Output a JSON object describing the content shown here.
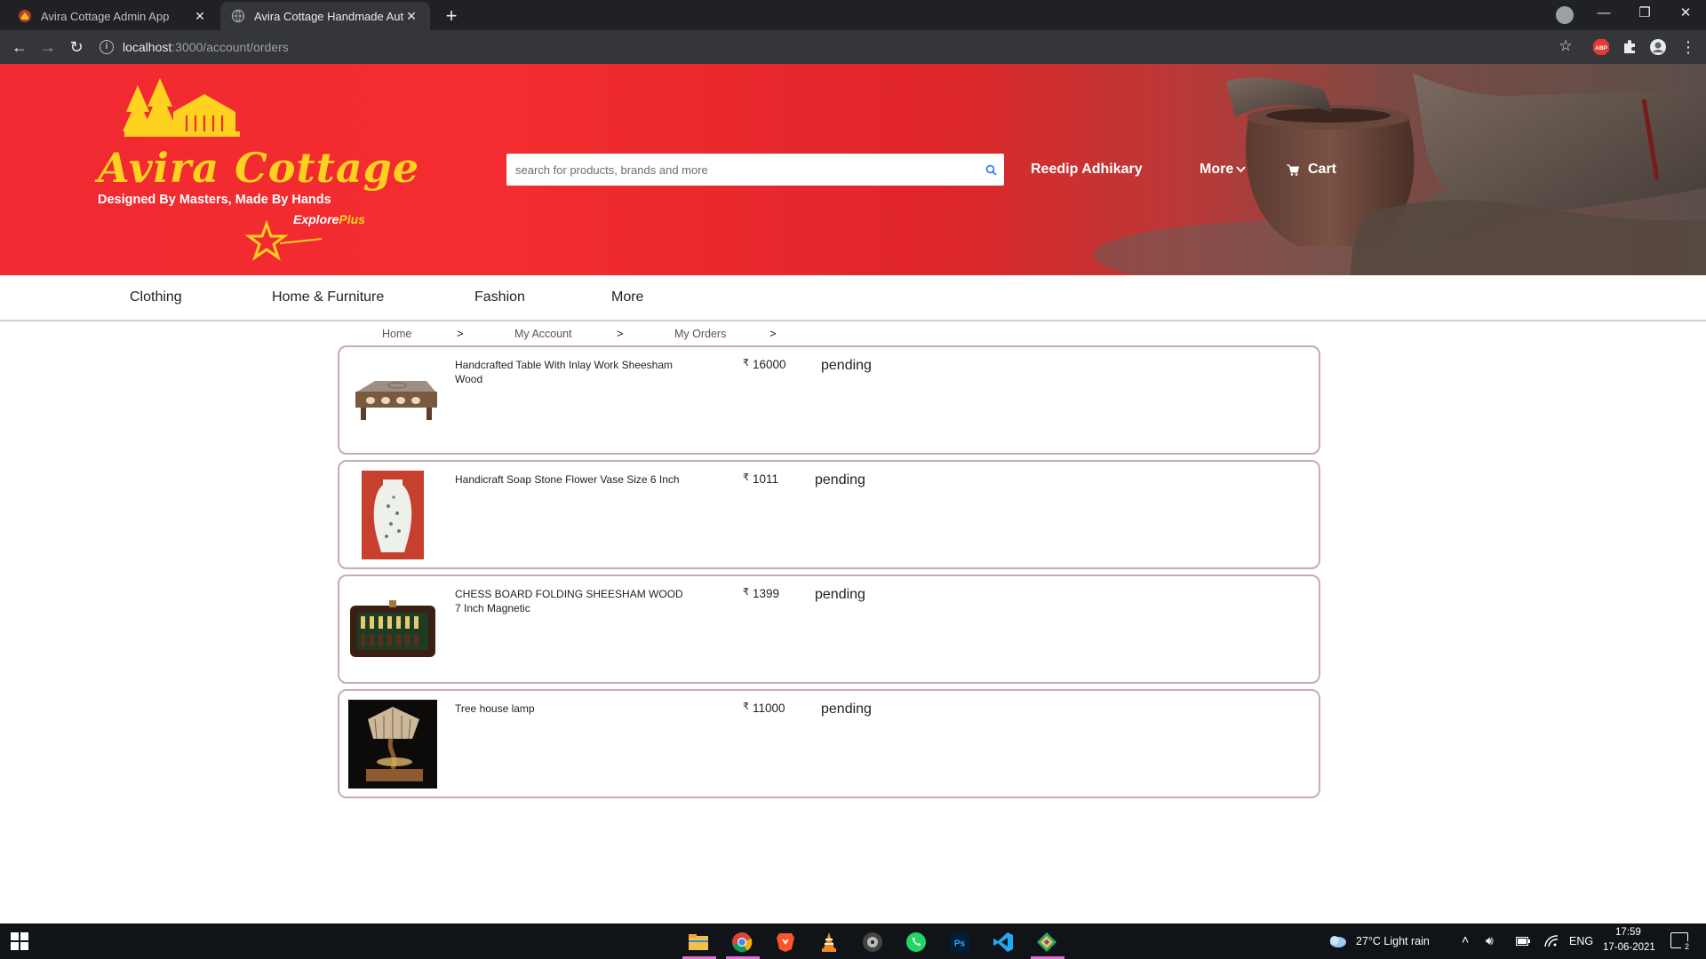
{
  "browser": {
    "tabs": [
      {
        "title": "Avira Cottage Admin App",
        "active": false
      },
      {
        "title": "Avira Cottage Handmade Authen",
        "active": true
      }
    ],
    "url_host": "localhost",
    "url_path": ":3000/account/orders",
    "new_tab_label": "+"
  },
  "header": {
    "logo_title": "Avira Cottage",
    "logo_tagline": "Designed By Masters, Made By Hands",
    "explore": "Explore",
    "explore_plus": "Plus",
    "search_placeholder": "search for products, brands and more",
    "user_name": "Reedip Adhikary",
    "more_label": "More",
    "cart_label": "Cart"
  },
  "categories": [
    "Clothing",
    "Home & Furniture",
    "Fashion",
    "More"
  ],
  "breadcrumb": [
    "Home",
    "My Account",
    "My Orders"
  ],
  "breadcrumb_separator": ">",
  "currency_symbol": "₹",
  "orders": [
    {
      "name": "Handcrafted Table With Inlay Work Sheesham Wood",
      "price": "16000",
      "status": "pending",
      "icon": "wooden-table-icon"
    },
    {
      "name": "Handicraft Soap Stone Flower Vase Size 6 Inch",
      "price": "1011",
      "status": "pending",
      "icon": "flower-vase-icon"
    },
    {
      "name": "CHESS BOARD FOLDING SHEESHAM WOOD 7 Inch Magnetic",
      "price": "1399",
      "status": "pending",
      "icon": "chess-board-icon"
    },
    {
      "name": "Tree house lamp",
      "price": "11000",
      "status": "pending",
      "icon": "tree-house-lamp-icon"
    }
  ],
  "taskbar": {
    "weather": "27°C  Light rain",
    "language": "ENG",
    "time": "17:59",
    "date": "17-06-2021",
    "notifications": "2"
  },
  "colors": {
    "header_red": "#f02a30",
    "logo_yellow": "#ffd21f",
    "card_border": "#c9abb1"
  }
}
